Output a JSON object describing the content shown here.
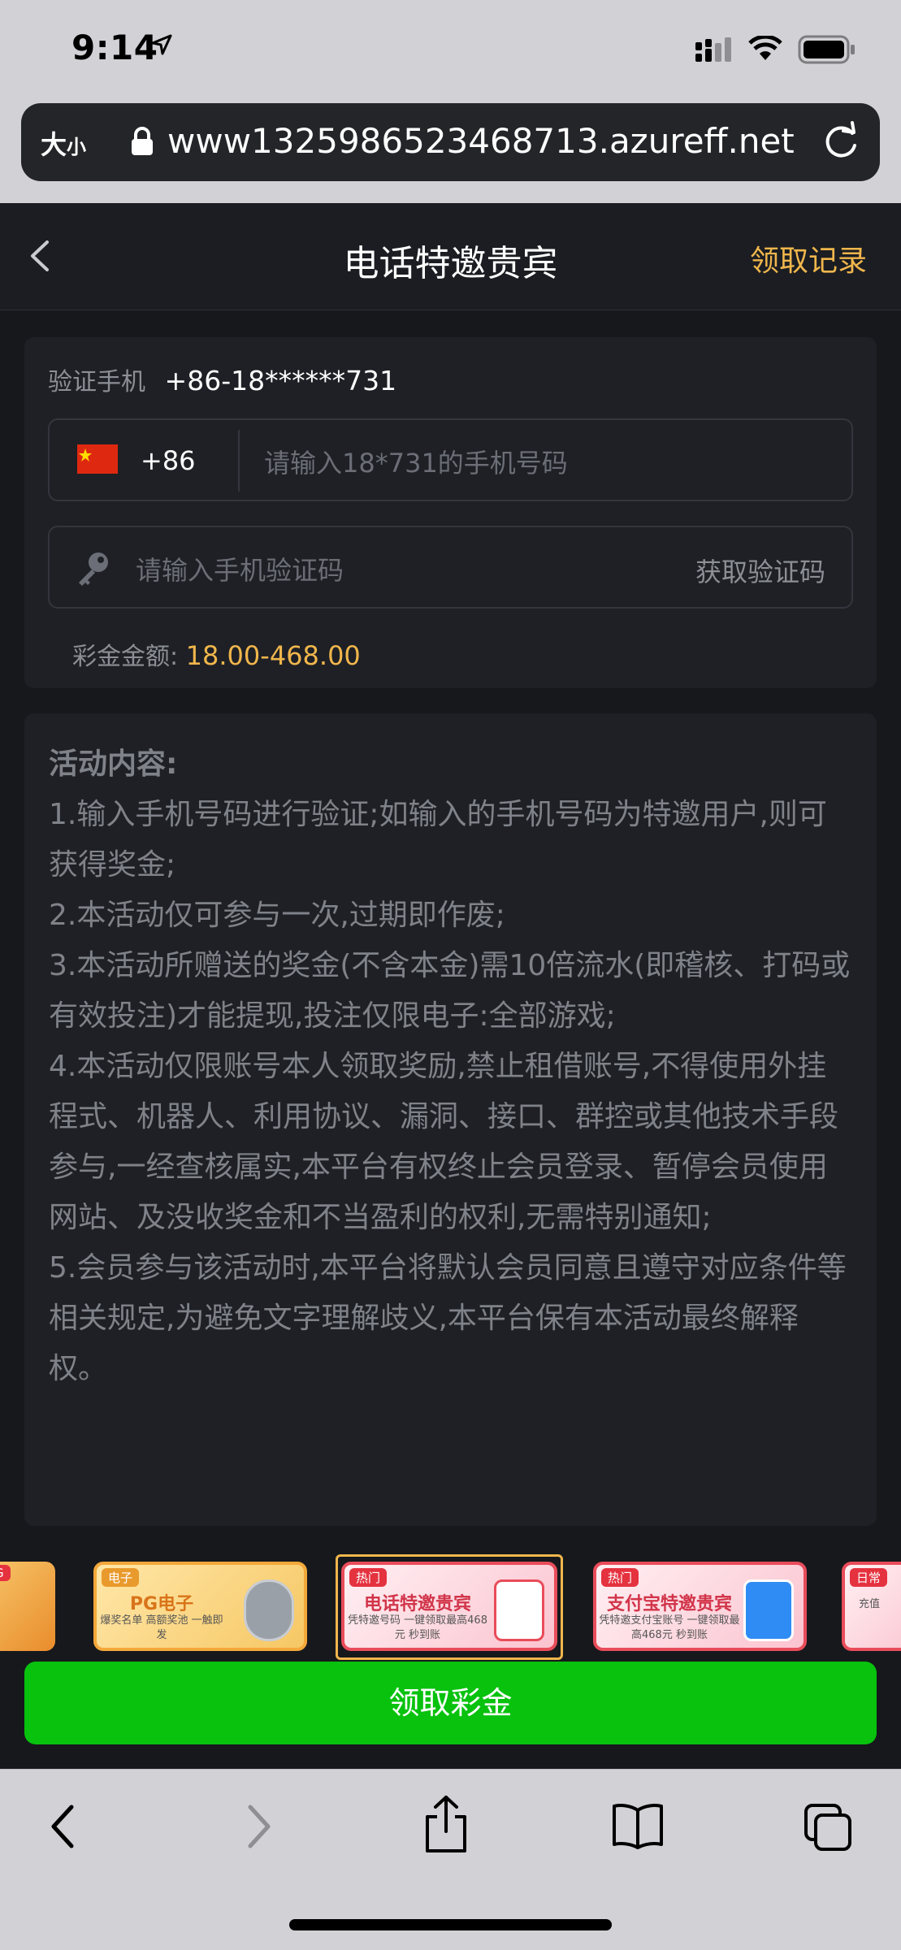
{
  "status_bar": {
    "time": "9:14"
  },
  "browser": {
    "aa_big": "大",
    "aa_small": "小",
    "url": "www1325986523468713.azureff.net"
  },
  "nav": {
    "title": "电话特邀贵宾",
    "record": "领取记录"
  },
  "form": {
    "verify_label": "验证手机",
    "verify_number": "+86-18******731",
    "country_code": "+86",
    "phone_placeholder": "请输入18*731的手机号码",
    "code_placeholder": "请输入手机验证码",
    "get_code": "获取验证码",
    "bonus_label": "彩金金额:",
    "bonus_value": "18.00-468.00"
  },
  "rules": {
    "title": "活动内容:",
    "items": [
      "1.输入手机号码进行验证;如输入的手机号码为特邀用户,则可获得奖金;",
      "2.本活动仅可参与一次,过期即作废;",
      "3.本活动所赠送的奖金(不含本金)需10倍流水(即稽核、打码或有效投注)才能提现,投注仅限电子:全部游戏;",
      "4.本活动仅限账号本人领取奖励,禁止租借账号,不得使用外挂程式、机器人、利用协议、漏洞、接口、群控或其他技术手段参与,一经查核属实,本平台有权终止会员登录、暂停会员使用网站、及没收奖金和不当盈利的权利,无需特别通知;",
      "5.会员参与该活动时,本平台将默认会员同意且遵守对应条件等相关规定,为避免文字理解歧义,本平台保有本活动最终解释权。"
    ]
  },
  "banners": [
    {
      "tag": "PG",
      "title": "",
      "sub": ""
    },
    {
      "tag": "电子",
      "title": "PG电子",
      "sub": "爆奖名单 高额奖池 一触即发"
    },
    {
      "tag": "热门",
      "title": "电话特邀贵宾",
      "sub": "凭特邀号码 一键领取最高468元 秒到账"
    },
    {
      "tag": "热门",
      "title": "支付宝特邀贵宾",
      "sub": "凭特邀支付宝账号 一键领取最高468元 秒到账"
    },
    {
      "tag": "日常",
      "title": "",
      "sub": "充值"
    }
  ],
  "claim_button": "领取彩金",
  "colors": {
    "accent": "#f0b64c",
    "claim": "#08c20e",
    "background": "#16181c"
  }
}
